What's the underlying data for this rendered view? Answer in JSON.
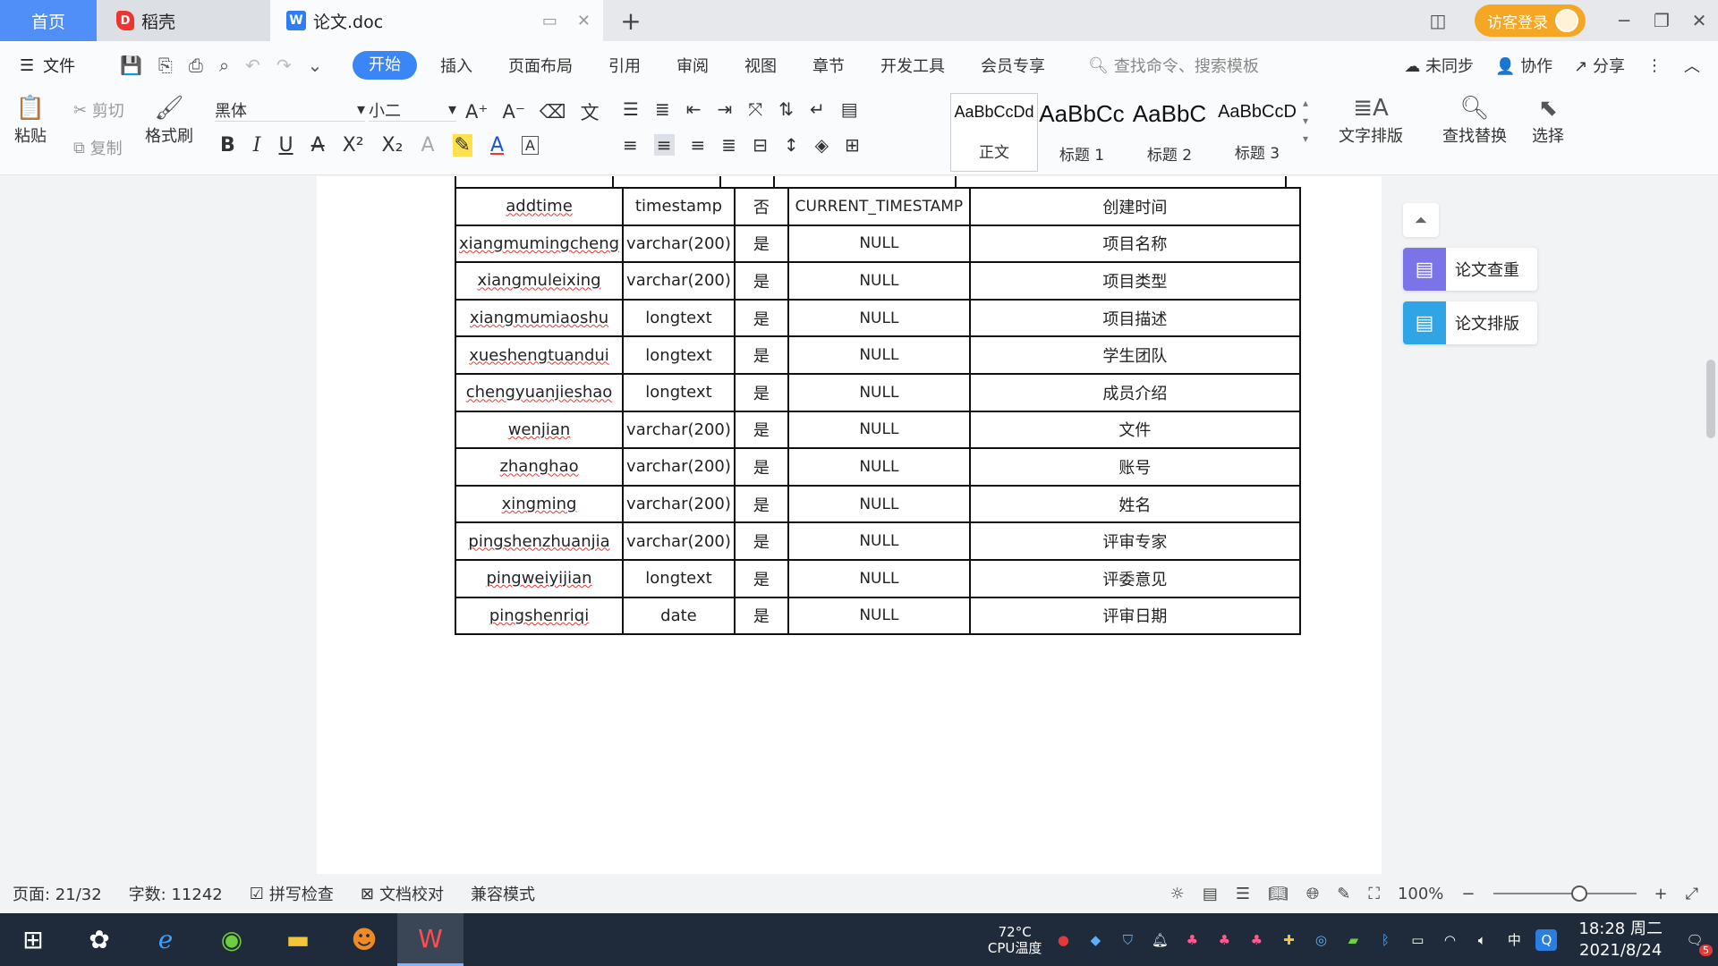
{
  "tabs": {
    "home": "首页",
    "daoke": "稻壳",
    "doc": "论文.doc"
  },
  "title_bar": {
    "login": "访客登录"
  },
  "menu": {
    "file": "文件",
    "items": [
      "开始",
      "插入",
      "页面布局",
      "引用",
      "审阅",
      "视图",
      "章节",
      "开发工具",
      "会员专享"
    ],
    "active": "开始",
    "search_placeholder": "查找命令、搜索模板",
    "unsynced": "未同步",
    "collab": "协作",
    "share": "分享"
  },
  "ribbon": {
    "paste": "粘贴",
    "cut": "剪切",
    "copy": "复制",
    "format_painter": "格式刷",
    "font_name": "黑体",
    "font_size": "小二",
    "styles": [
      {
        "preview": "AaBbCcDd",
        "label": "正文"
      },
      {
        "preview": "AaBbCc",
        "label": "标题 1"
      },
      {
        "preview": "AaBbC",
        "label": "标题 2"
      },
      {
        "preview": "AaBbCcD",
        "label": "标题 3"
      }
    ],
    "text_layout": "文字排版",
    "find_replace": "查找替换",
    "select": "选择"
  },
  "table": {
    "rows": [
      [
        "addtime",
        "timestamp",
        "否",
        "CURRENT_TIMESTAMP",
        "创建时间"
      ],
      [
        "xiangmumingcheng",
        "varchar(200)",
        "是",
        "NULL",
        "项目名称"
      ],
      [
        "xiangmuleixing",
        "varchar(200)",
        "是",
        "NULL",
        "项目类型"
      ],
      [
        "xiangmumiaoshu",
        "longtext",
        "是",
        "NULL",
        "项目描述"
      ],
      [
        "xueshengtuandui",
        "longtext",
        "是",
        "NULL",
        "学生团队"
      ],
      [
        "chengyuanjieshao",
        "longtext",
        "是",
        "NULL",
        "成员介绍"
      ],
      [
        "wenjian",
        "varchar(200)",
        "是",
        "NULL",
        "文件"
      ],
      [
        "zhanghao",
        "varchar(200)",
        "是",
        "NULL",
        "账号"
      ],
      [
        "xingming",
        "varchar(200)",
        "是",
        "NULL",
        "姓名"
      ],
      [
        "pingshenzhuanjia",
        "varchar(200)",
        "是",
        "NULL",
        "评审专家"
      ],
      [
        "pingweiyijian",
        "longtext",
        "是",
        "NULL",
        "评委意见"
      ],
      [
        "pingshenriqi",
        "date",
        "是",
        "NULL",
        "评审日期"
      ]
    ]
  },
  "side_panel": {
    "check": "论文查重",
    "layout": "论文排版"
  },
  "status": {
    "page": "页面: 21/32",
    "words": "字数: 11242",
    "spell": "拼写检查",
    "proof": "文档校对",
    "compat": "兼容模式",
    "zoom": "100%",
    "zoom_level": 0.6
  },
  "taskbar": {
    "cpu_temp": "72°C",
    "cpu_label": "CPU温度",
    "ime": "中",
    "time": "18:28 周二",
    "date": "2021/8/24",
    "notif_count": "5"
  }
}
